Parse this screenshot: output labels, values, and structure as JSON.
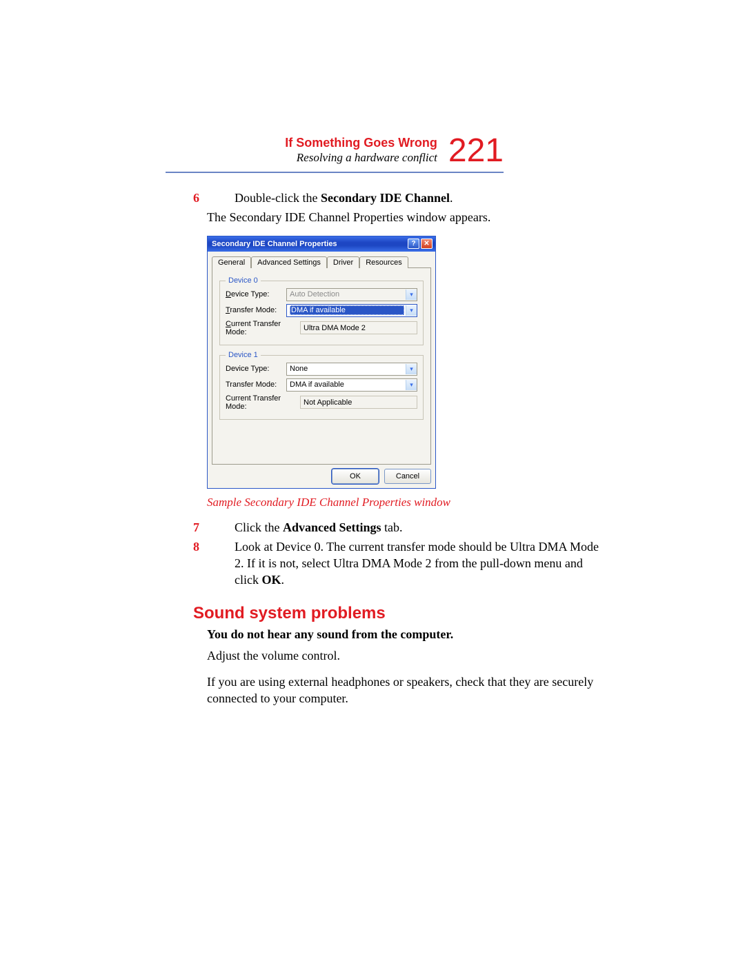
{
  "header": {
    "chapter": "If Something Goes Wrong",
    "subtitle": "Resolving a hardware conflict",
    "page_number": "221"
  },
  "steps": {
    "s6": {
      "num": "6",
      "pre": "Double-click the ",
      "bold": "Secondary IDE Channel",
      "post": "."
    },
    "s6_follow": "The Secondary IDE Channel Properties window appears.",
    "s7": {
      "num": "7",
      "pre": "Click the ",
      "bold": "Advanced Settings",
      "post": " tab."
    },
    "s8": {
      "num": "8",
      "pre": "Look at Device 0. The current transfer mode should be Ultra DMA Mode 2. If it is not, select Ultra DMA Mode 2 from the pull-down menu and click ",
      "bold": "OK",
      "post": "."
    }
  },
  "caption": "Sample Secondary IDE Channel Properties window",
  "section": {
    "title": "Sound system problems",
    "topic": "You do not hear any sound from the computer.",
    "p1": "Adjust the volume control.",
    "p2": "If you are using external headphones or speakers, check that they are securely connected to your computer."
  },
  "dialog": {
    "title": "Secondary IDE Channel Properties",
    "help": "?",
    "close": "✕",
    "tabs": {
      "general": "General",
      "advanced": "Advanced Settings",
      "driver": "Driver",
      "resources": "Resources"
    },
    "device0": {
      "legend": "Device 0",
      "type_label": "Device Type:",
      "type_value": "Auto Detection",
      "mode_label": "Transfer Mode:",
      "mode_value": "DMA if available",
      "current_label": "Current Transfer Mode:",
      "current_value": "Ultra DMA Mode 2"
    },
    "device1": {
      "legend": "Device 1",
      "type_label": "Device Type:",
      "type_value": "None",
      "mode_label": "Transfer Mode:",
      "mode_value": "DMA if available",
      "current_label": "Current Transfer Mode:",
      "current_value": "Not Applicable"
    },
    "ok": "OK",
    "cancel": "Cancel"
  }
}
